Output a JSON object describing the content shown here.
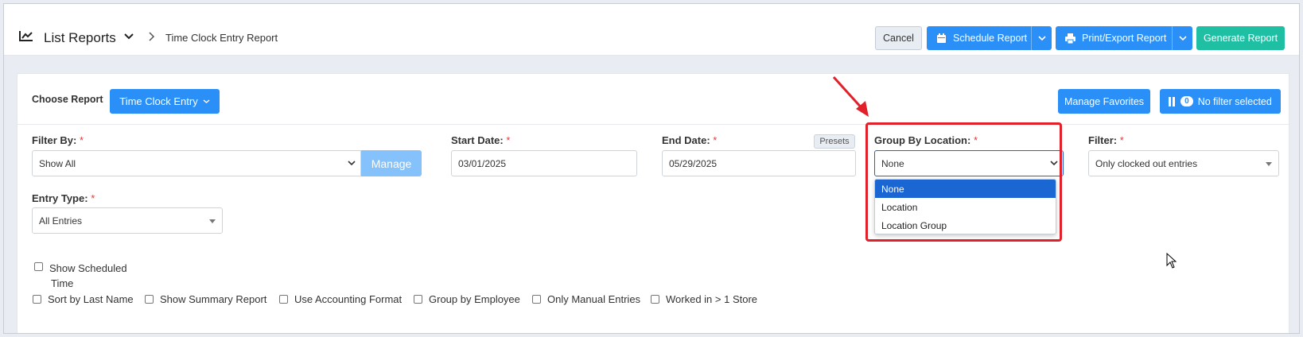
{
  "header": {
    "title": "List Reports",
    "breadcrumb": "Time Clock Entry Report",
    "cancel_label": "Cancel",
    "schedule_label": "Schedule Report",
    "print_label": "Print/Export Report",
    "generate_label": "Generate Report"
  },
  "report_bar": {
    "choose_label": "Choose Report",
    "report_select": "Time Clock Entry",
    "manage_favorites": "Manage Favorites",
    "filter_count": "0",
    "filter_status": "No filter selected"
  },
  "form": {
    "filter_by": {
      "label": "Filter By:",
      "required": "*",
      "value": "Show All",
      "manage_label": "Manage"
    },
    "start_date": {
      "label": "Start Date:",
      "required": "*",
      "value": "03/01/2025"
    },
    "end_date": {
      "label": "End Date:",
      "required": "*",
      "value": "05/29/2025",
      "presets_label": "Presets"
    },
    "group_by_location": {
      "label": "Group By Location:",
      "required": "*",
      "value": "None",
      "options": [
        "None",
        "Location",
        "Location Group"
      ],
      "selected_option": "None"
    },
    "filter": {
      "label": "Filter:",
      "required": "*",
      "value": "Only clocked out entries"
    },
    "entry_type": {
      "label": "Entry Type:",
      "required": "*",
      "value": "All Entries"
    }
  },
  "checkboxes": {
    "show_scheduled_line1": "Show Scheduled",
    "show_scheduled_line2": "Time",
    "sort_last_name": "Sort by Last Name",
    "show_summary": "Show Summary Report",
    "accounting_format": "Use Accounting Format",
    "group_employee": "Group by Employee",
    "manual_entries": "Only Manual Entries",
    "worked_multi_store": "Worked in > 1 Store"
  },
  "colors": {
    "primary": "#2a8ff7",
    "success": "#1ebfa3",
    "highlight": "#e2202a",
    "selected_option": "#1a66d2"
  },
  "icons": [
    "chart-line-icon",
    "chevron-down-icon",
    "chevron-right-icon",
    "calendar-icon",
    "printer-icon",
    "filter-icon",
    "arrow-annotation",
    "mouse-cursor-icon"
  ]
}
